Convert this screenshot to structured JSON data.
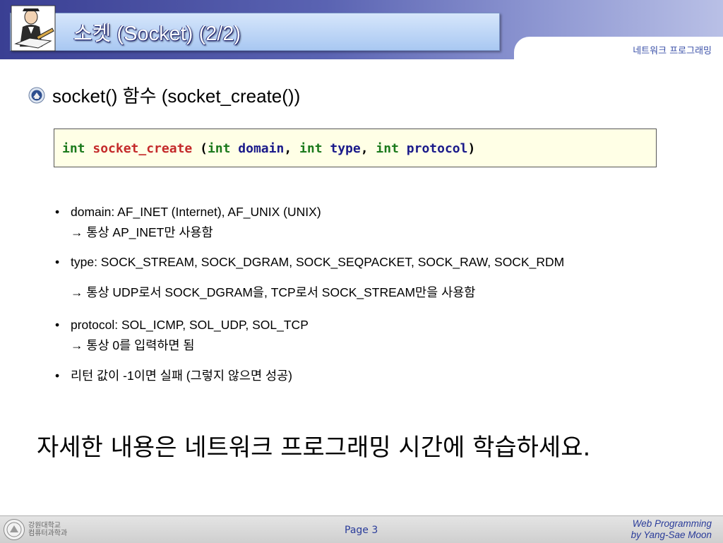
{
  "header": {
    "title": "소켓 (Socket) (2/2)",
    "course_tab": "네트워크 프로그래밍"
  },
  "heading": "socket() 함수 (socket_create())",
  "code": {
    "ret_type": "int",
    "func": "socket_create",
    "open_paren": "(",
    "p1_type": "int",
    "p1_name": "domain",
    "comma1": ",",
    "p2_type": "int",
    "p2_name": "type",
    "comma2": ",",
    "p3_type": "int",
    "p3_name": "protocol",
    "close_paren": ")"
  },
  "bullets": [
    {
      "line1": "domain: AF_INET (Internet), AF_UNIX (UNIX)",
      "line2": "→ 통상 AP_INET만 사용함"
    },
    {
      "line1": "type: SOCK_STREAM, SOCK_DGRAM, SOCK_SEQPACKET, SOCK_RAW, SOCK_RDM",
      "line2": "→ 통상 UDP로서 SOCK_DGRAM을, TCP로서 SOCK_STREAM만을 사용함"
    },
    {
      "line1": "protocol: SOL_ICMP, SOL_UDP, SOL_TCP",
      "line2": "→ 통상 0를 입력하면 됨"
    },
    {
      "line1": "리턴 값이 -1이면 실패 (그렇지 않으면 성공)"
    }
  ],
  "bullet_char": "•",
  "note": "자세한 내용은 네트워크 프로그래밍 시간에 학습하세요.",
  "footer": {
    "school_line1": "강원대학교",
    "school_line2": "컴퓨터과학과",
    "page": "Page 3",
    "credit1": "Web Programming",
    "credit2": "by Yang-Sae Moon"
  },
  "colors": {
    "header_dark": "#3a3f93",
    "title_box": "#a9c8f2",
    "code_keyword": "#1c7a1c",
    "code_function": "#c42a2a",
    "code_param": "#1a1a8a",
    "code_bg": "#ffffe6",
    "footer_text": "#2a3c9a"
  }
}
